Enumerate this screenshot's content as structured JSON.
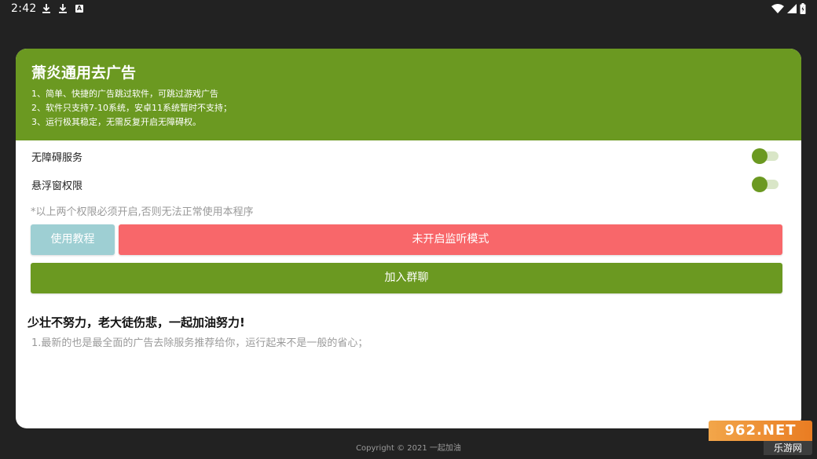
{
  "status_bar": {
    "time": "2:42",
    "left_icons": [
      "download-icon",
      "download-icon",
      "accessibility-notification-icon"
    ],
    "right_icons": [
      "wifi-icon",
      "signal-icon",
      "battery-charging-icon"
    ],
    "a_badge": "A"
  },
  "header": {
    "title": "萧炎通用去广告",
    "desc_1": "1、简单、快捷的广告跳过软件，可跳过游戏广告",
    "desc_2": "2、软件只支持7-10系统，安卓11系统暂时不支持；",
    "desc_3": "3、运行极其稳定，无需反复开启无障碍权。",
    "color": "#6b9921"
  },
  "permissions": {
    "accessibility_label": "无障碍服务",
    "overlay_label": "悬浮窗权限",
    "notice": "*以上两个权限必须开启,否则无法正常使用本程序"
  },
  "buttons": {
    "tutorial": "使用教程",
    "monitor": "未开启监听模式",
    "join_group": "加入群聊",
    "tutorial_color": "#9ecfd3",
    "monitor_color": "#f8676a"
  },
  "content": {
    "slogan": "少壮不努力，老大徒伤悲，一起加油努力!",
    "tip": "1.最新的也是最全面的广告去除服务推荐给你，运行起来不是一般的省心；"
  },
  "footer": {
    "copyright": "Copyright © 2021 一起加油"
  },
  "watermark": {
    "top": "962.NET",
    "bottom": "乐游网"
  }
}
